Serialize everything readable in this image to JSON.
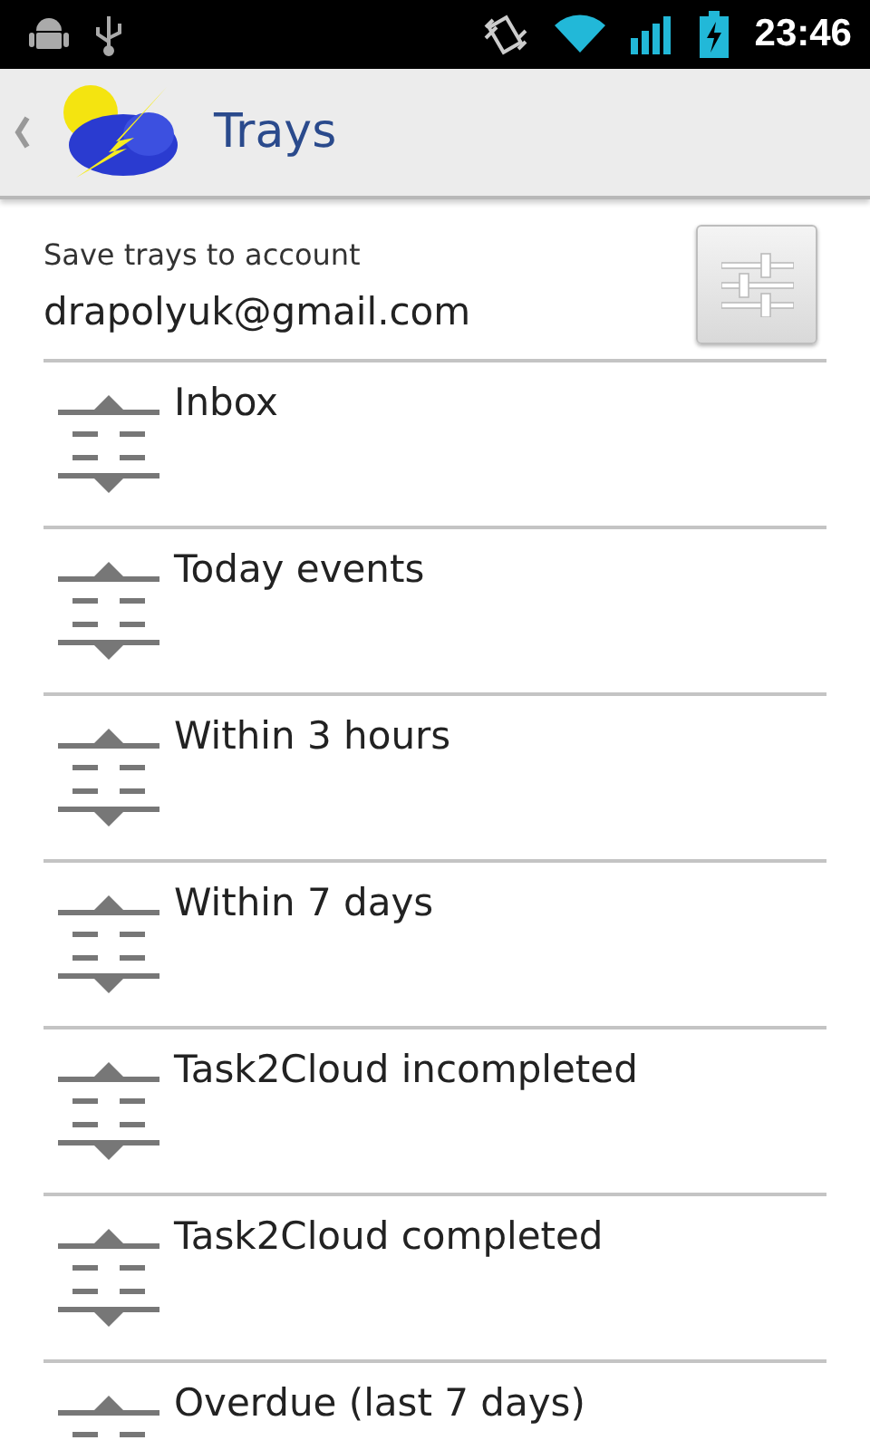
{
  "status_bar": {
    "time": "23:46"
  },
  "action_bar": {
    "title": "Trays"
  },
  "account": {
    "label": "Save trays to account",
    "email": "drapolyuk@gmail.com"
  },
  "trays": [
    {
      "name": "Inbox"
    },
    {
      "name": "Today events"
    },
    {
      "name": "Within 3 hours"
    },
    {
      "name": "Within 7 days"
    },
    {
      "name": "Task2Cloud incompleted"
    },
    {
      "name": "Task2Cloud completed"
    },
    {
      "name": "Overdue (last 7 days)"
    }
  ]
}
